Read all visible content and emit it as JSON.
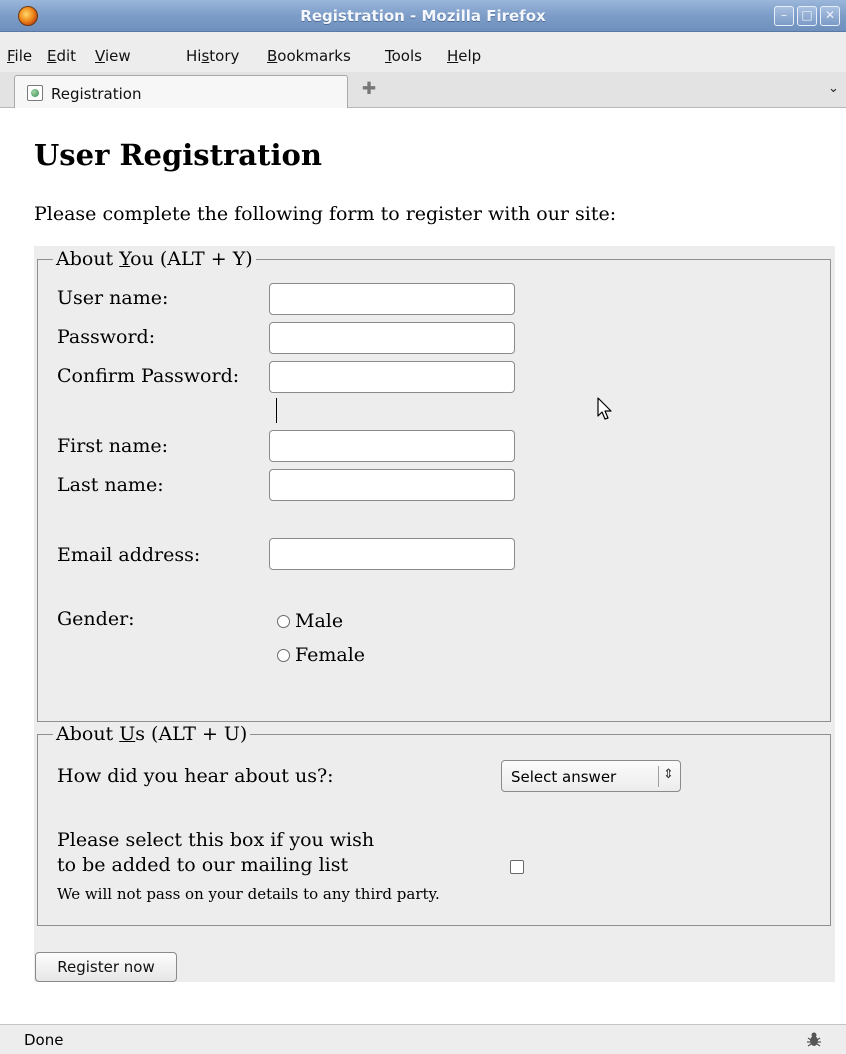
{
  "window": {
    "title": "Registration - Mozilla Firefox",
    "controls": {
      "minimize": "–",
      "maximize": "□",
      "close": "✕"
    }
  },
  "menubar": {
    "items": [
      {
        "label_pre": "",
        "accel": "F",
        "label_post": "ile"
      },
      {
        "label_pre": "",
        "accel": "E",
        "label_post": "dit"
      },
      {
        "label_pre": "",
        "accel": "V",
        "label_post": "iew"
      },
      {
        "label_pre": "Hi",
        "accel": "s",
        "label_post": "tory"
      },
      {
        "label_pre": "",
        "accel": "B",
        "label_post": "ookmarks"
      },
      {
        "label_pre": "",
        "accel": "T",
        "label_post": "ools"
      },
      {
        "label_pre": "",
        "accel": "H",
        "label_post": "elp"
      }
    ]
  },
  "tabs": {
    "active_label": "Registration",
    "new_tab_glyph": "✚",
    "list_glyph": "⌄"
  },
  "page": {
    "heading": "User Registration",
    "intro": "Please complete the following form to register with our site:",
    "about_you": {
      "legend_pre": "About ",
      "legend_accel": "Y",
      "legend_post": "ou (ALT + Y)",
      "username_label": "User name:",
      "password_label": "Password:",
      "confirm_label": "Confirm Password:",
      "firstname_label": "First name:",
      "lastname_label": "Last name:",
      "email_label": "Email address:",
      "gender_label": "Gender:",
      "gender_options": [
        "Male",
        "Female"
      ]
    },
    "about_us": {
      "legend_pre": "About ",
      "legend_accel": "U",
      "legend_post": "s (ALT + U)",
      "heard_label": "How did you hear about us?:",
      "heard_select_value": "Select answer",
      "mailing_line1": "Please select this box if you wish",
      "mailing_line2": "to be added to our mailing list",
      "privacy_note": "We will not pass on your details to any third party."
    },
    "submit_label": "Register now"
  },
  "statusbar": {
    "text": "Done"
  }
}
